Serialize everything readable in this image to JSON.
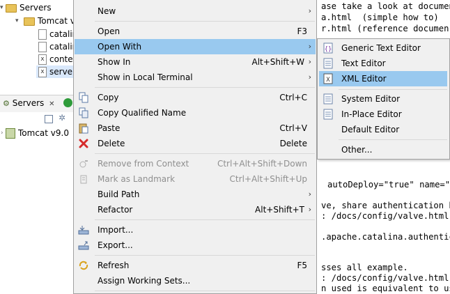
{
  "tree": {
    "rows": [
      {
        "label": "Servers",
        "twisty": "▾"
      },
      {
        "label": "Tomcat v",
        "twisty": "▾"
      },
      {
        "label": "catalin"
      },
      {
        "label": "catalin"
      },
      {
        "label": "contex",
        "xicon": "x"
      },
      {
        "label": "server.",
        "xicon": "x"
      }
    ]
  },
  "servers_view": {
    "tab_label": "Servers",
    "close_glyph": "✕",
    "item": "Tomcat v9.0"
  },
  "editor_lines": [
    {
      "text": "ase take a look at documen"
    },
    {
      "text": "a.html  (simple how to)"
    },
    {
      "text": "r.html (reference documen"
    },
    {
      "text": "autoDeploy=\"true\" name=\"lo"
    },
    {
      "text": "ve, share authentication b"
    },
    {
      "text": ": /docs/config/valve.html"
    },
    {
      "text": ".apache.catalina.authentic"
    },
    {
      "text": "sses all example."
    },
    {
      "text": ": /docs/config/valve.html"
    },
    {
      "text": "n used is equivalent to us"
    }
  ],
  "context_menu": {
    "items": [
      {
        "label": "New",
        "shortcut": "",
        "submenu": true,
        "icon": ""
      },
      {
        "label": "Open",
        "shortcut": "F3",
        "icon": ""
      },
      {
        "label": "Open With",
        "shortcut": "",
        "submenu": true,
        "highlighted": true,
        "icon": ""
      },
      {
        "label": "Show In",
        "shortcut": "Alt+Shift+W",
        "submenu": true,
        "icon": ""
      },
      {
        "label": "Show in Local Terminal",
        "shortcut": "",
        "submenu": true,
        "icon": ""
      },
      {
        "label": "Copy",
        "shortcut": "Ctrl+C",
        "icon": "copy-icon"
      },
      {
        "label": "Copy Qualified Name",
        "shortcut": "",
        "icon": "copy-qualified-icon"
      },
      {
        "label": "Paste",
        "shortcut": "Ctrl+V",
        "icon": "paste-icon"
      },
      {
        "label": "Delete",
        "shortcut": "Delete",
        "icon": "delete-icon"
      },
      {
        "label": "Remove from Context",
        "shortcut": "Ctrl+Alt+Shift+Down",
        "disabled": true,
        "icon": "remove-context-icon"
      },
      {
        "label": "Mark as Landmark",
        "shortcut": "Ctrl+Alt+Shift+Up",
        "disabled": true,
        "icon": "landmark-icon"
      },
      {
        "label": "Build Path",
        "shortcut": "",
        "submenu": true,
        "icon": ""
      },
      {
        "label": "Refactor",
        "shortcut": "Alt+Shift+T",
        "submenu": true,
        "icon": ""
      },
      {
        "label": "Import...",
        "shortcut": "",
        "icon": "import-icon"
      },
      {
        "label": "Export...",
        "shortcut": "",
        "icon": "export-icon"
      },
      {
        "label": "Refresh",
        "shortcut": "F5",
        "icon": "refresh-icon"
      },
      {
        "label": "Assign Working Sets...",
        "shortcut": "",
        "icon": ""
      }
    ],
    "arrow_glyph": "›"
  },
  "open_with_submenu": {
    "items": [
      {
        "label": "Generic Text Editor",
        "icon": "generic-text-editor-icon"
      },
      {
        "label": "Text Editor",
        "icon": "text-editor-icon"
      },
      {
        "label": "XML Editor",
        "icon": "xml-editor-icon",
        "highlighted": true
      },
      {
        "label": "System Editor",
        "icon": "system-editor-icon"
      },
      {
        "label": "In-Place Editor",
        "icon": "in-place-editor-icon"
      },
      {
        "label": "Default Editor",
        "icon": ""
      },
      {
        "label": "Other...",
        "icon": ""
      }
    ]
  },
  "colors": {
    "highlight": "#99c9ef",
    "menu_bg": "#f0f0f0",
    "disabled_text": "#8f8f8f",
    "delete_red": "#d62b2b"
  }
}
